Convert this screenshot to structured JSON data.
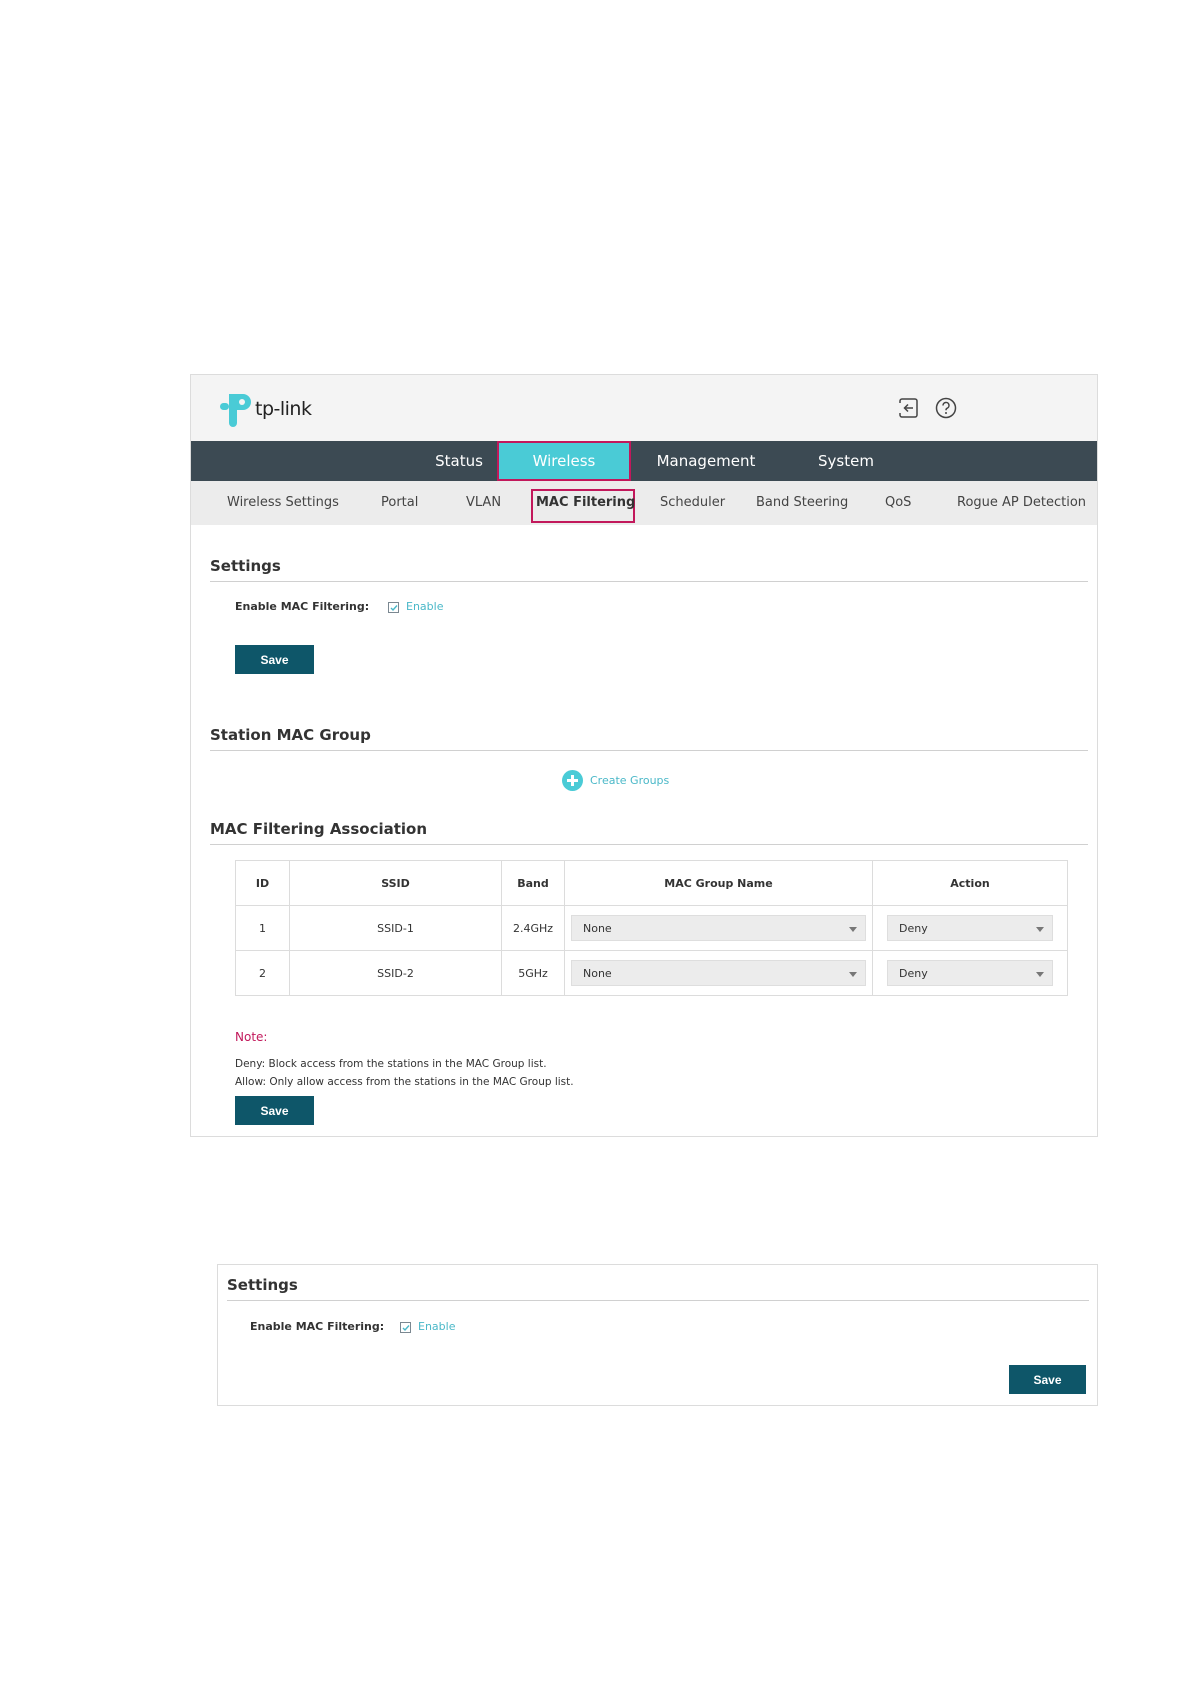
{
  "brand": {
    "logo_text": "tp-link",
    "accent": "#4acbd6",
    "dark": "#3c4a53",
    "button": "#0e5669",
    "highlight": "#c2185b"
  },
  "header_icons": [
    {
      "name": "logout-icon"
    },
    {
      "name": "help-icon"
    }
  ],
  "main_nav": [
    {
      "label": "Status",
      "active": false
    },
    {
      "label": "Wireless",
      "active": true
    },
    {
      "label": "Management",
      "active": false
    },
    {
      "label": "System",
      "active": false
    }
  ],
  "sub_nav": [
    {
      "label": "Wireless Settings",
      "active": false
    },
    {
      "label": "Portal",
      "active": false
    },
    {
      "label": "VLAN",
      "active": false
    },
    {
      "label": "MAC Filtering",
      "active": true
    },
    {
      "label": "Scheduler",
      "active": false
    },
    {
      "label": "Band Steering",
      "active": false
    },
    {
      "label": "QoS",
      "active": false
    },
    {
      "label": "Rogue AP Detection",
      "active": false
    }
  ],
  "settings": {
    "title": "Settings",
    "enable_label": "Enable MAC Filtering:",
    "checkbox_label": "Enable",
    "checked": true,
    "save_label": "Save"
  },
  "station_group": {
    "title": "Station MAC Group",
    "create_label": "Create Groups"
  },
  "association": {
    "title": "MAC Filtering Association",
    "columns": [
      "ID",
      "SSID",
      "Band",
      "MAC Group Name",
      "Action"
    ],
    "rows": [
      {
        "id": "1",
        "ssid": "SSID-1",
        "band": "2.4GHz",
        "group": "None",
        "action": "Deny"
      },
      {
        "id": "2",
        "ssid": "SSID-2",
        "band": "5GHz",
        "group": "None",
        "action": "Deny"
      }
    ],
    "note_title": "Note:",
    "note_lines": [
      "Deny: Block access from the stations in the MAC Group list.",
      "Allow: Only allow access from the stations in the MAC Group list."
    ],
    "save_label": "Save"
  },
  "settings_panel2": {
    "title": "Settings",
    "enable_label": "Enable MAC Filtering:",
    "checkbox_label": "Enable",
    "checked": true,
    "save_label": "Save"
  }
}
